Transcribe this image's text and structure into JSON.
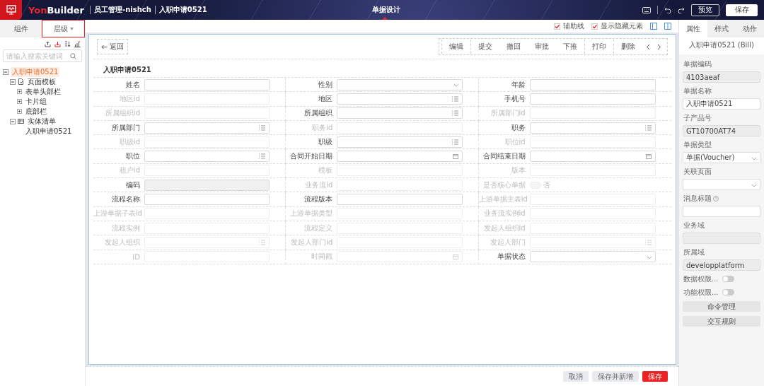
{
  "topbar": {
    "brand": {
      "first": "Yon",
      "rest": "Builder"
    },
    "breadcrumbs": [
      "员工管理-nishch",
      "入职申请0521"
    ],
    "mode": "单据设计",
    "preview": "预览",
    "save": "保存"
  },
  "left_panel": {
    "tabs": [
      {
        "label": "组件",
        "selected": false
      },
      {
        "label": "层级",
        "selected": true
      }
    ],
    "search": {
      "placeholder": "请输入搜索关键词"
    },
    "tree": [
      {
        "label": "入职申请0521",
        "selected": true,
        "expanded": true,
        "children": [
          {
            "label": "页面模板",
            "kind": "page",
            "selected": false,
            "expanded": true,
            "children": [
              {
                "label": "表单头部栏",
                "selected": false,
                "expanded": false
              },
              {
                "label": "卡片组",
                "selected": false,
                "expanded": false
              },
              {
                "label": "底部栏",
                "selected": false,
                "expanded": false
              }
            ]
          },
          {
            "label": "实体清单",
            "kind": "table",
            "selected": false,
            "expanded": true,
            "children": [
              {
                "label": "入职申请0521",
                "selected": false
              }
            ]
          }
        ]
      }
    ]
  },
  "canvas_toolbar": {
    "options": [
      {
        "label": "辅助线",
        "checked": true
      },
      {
        "label": "显示隐藏元素",
        "checked": true
      }
    ]
  },
  "form": {
    "back": "返回",
    "actions": [
      {
        "kind": "text",
        "label": "编辑",
        "group_start": true
      },
      {
        "kind": "text",
        "label": "提交",
        "group_start": true
      },
      {
        "kind": "text",
        "label": "撤回",
        "group_start": false
      },
      {
        "kind": "text",
        "label": "审批",
        "group_start": false
      },
      {
        "kind": "text",
        "label": "下推",
        "group_start": false
      },
      {
        "kind": "text",
        "label": "打印",
        "group_start": true
      },
      {
        "kind": "text",
        "label": "删除",
        "group_start": true
      },
      {
        "kind": "prev",
        "group_start": false
      },
      {
        "kind": "next",
        "group_start": false
      }
    ],
    "title": "入职申请0521",
    "fields": [
      {
        "label": "姓名",
        "kind": "text",
        "hidden": false
      },
      {
        "label": "性别",
        "kind": "select",
        "hidden": false
      },
      {
        "label": "年龄",
        "kind": "text",
        "hidden": false
      },
      {
        "label": "地区id",
        "kind": "text",
        "hidden": true
      },
      {
        "label": "地区",
        "kind": "ref",
        "hidden": false
      },
      {
        "label": "手机号",
        "kind": "text",
        "hidden": false
      },
      {
        "label": "所属组织id",
        "kind": "text",
        "hidden": true
      },
      {
        "label": "所属组织",
        "kind": "ref",
        "hidden": false
      },
      {
        "label": "所属部门id",
        "kind": "text",
        "hidden": true
      },
      {
        "label": "所属部门",
        "kind": "ref",
        "hidden": false
      },
      {
        "label": "职务id",
        "kind": "text",
        "hidden": true
      },
      {
        "label": "职务",
        "kind": "ref",
        "hidden": false
      },
      {
        "label": "职级id",
        "kind": "text",
        "hidden": true
      },
      {
        "label": "职级",
        "kind": "ref",
        "hidden": false
      },
      {
        "label": "职位id",
        "kind": "text",
        "hidden": true
      },
      {
        "label": "职位",
        "kind": "ref",
        "hidden": false
      },
      {
        "label": "合同开始日期",
        "kind": "date",
        "hidden": false
      },
      {
        "label": "合同结束日期",
        "kind": "date",
        "hidden": false
      },
      {
        "label": "租户id",
        "kind": "text",
        "hidden": true
      },
      {
        "label": "模板",
        "kind": "text",
        "hidden": true
      },
      {
        "label": "版本",
        "kind": "text",
        "hidden": true
      },
      {
        "label": "编码",
        "kind": "readonly",
        "hidden": false
      },
      {
        "label": "业务流id",
        "kind": "text",
        "hidden": true
      },
      {
        "label": "是否核心单据",
        "kind": "switch",
        "hidden": true,
        "on": false,
        "value": "否"
      },
      {
        "label": "流程名称",
        "kind": "text",
        "hidden": false
      },
      {
        "label": "流程版本",
        "kind": "text",
        "hidden": false
      },
      {
        "label": "上游单据主表id",
        "kind": "text",
        "hidden": true
      },
      {
        "label": "上游单据子表id",
        "kind": "text",
        "hidden": true
      },
      {
        "label": "上游单据类型",
        "kind": "text",
        "hidden": true
      },
      {
        "label": "业务流实例id",
        "kind": "text",
        "hidden": true
      },
      {
        "label": "流程实例",
        "kind": "text",
        "hidden": true
      },
      {
        "label": "流程定义",
        "kind": "text",
        "hidden": true
      },
      {
        "label": "发起人组织id",
        "kind": "text",
        "hidden": true
      },
      {
        "label": "发起人组织",
        "kind": "ref",
        "hidden": true
      },
      {
        "label": "发起人部门id",
        "kind": "text",
        "hidden": true
      },
      {
        "label": "发起人部门",
        "kind": "ref",
        "hidden": true
      },
      {
        "label": "ID",
        "kind": "text",
        "hidden": true
      },
      {
        "label": "时间戳",
        "kind": "date",
        "hidden": true
      },
      {
        "label": "单据状态",
        "kind": "select",
        "hidden": false
      }
    ],
    "footer": [
      {
        "label": "取消",
        "kind": "default"
      },
      {
        "label": "保存并新增",
        "kind": "default"
      },
      {
        "label": "保存",
        "kind": "primary"
      }
    ]
  },
  "right_panel": {
    "tabs": [
      {
        "label": "属性",
        "selected": true
      },
      {
        "label": "样式",
        "selected": false
      },
      {
        "label": "动作",
        "selected": false
      }
    ],
    "title": "入职申请0521 (Bill)",
    "properties": [
      {
        "kind": "readonly",
        "label": "单据编码",
        "value": "4103aeaf"
      },
      {
        "kind": "input",
        "label": "单据名称",
        "value": "入职申请0521"
      },
      {
        "kind": "readonly",
        "label": "子产品号",
        "value": "GT10700AT74"
      },
      {
        "kind": "select",
        "label": "单据类型",
        "value": "单据(Voucher)"
      },
      {
        "kind": "select",
        "label": "关联页面"
      },
      {
        "kind": "input",
        "label": "消息标题",
        "help": true
      },
      {
        "kind": "readonly",
        "label": "业务域"
      },
      {
        "kind": "readonly",
        "label": "所属域",
        "value": "developplatform"
      },
      {
        "kind": "switch",
        "label": "数据权限...",
        "on": false
      },
      {
        "kind": "switch",
        "label": "功能权限...",
        "on": false
      },
      {
        "kind": "button",
        "label": "命令管理"
      },
      {
        "kind": "button",
        "label": "交互规则"
      }
    ]
  }
}
